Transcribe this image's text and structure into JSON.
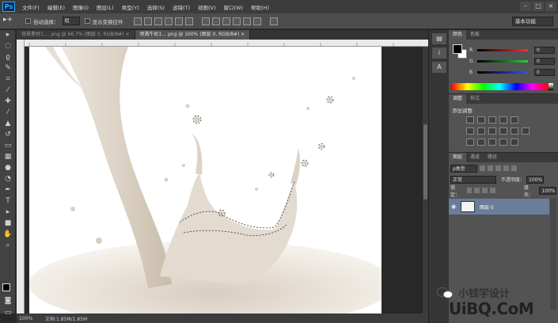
{
  "menubar": {
    "logo": "Ps",
    "items": [
      "文件(F)",
      "编辑(E)",
      "图像(I)",
      "图层(L)",
      "类型(Y)",
      "选择(S)",
      "滤镜(T)",
      "视图(V)",
      "窗口(W)",
      "帮助(H)"
    ]
  },
  "options": {
    "auto_select_label": "自动选择：",
    "auto_select_value": "组",
    "show_transform_label": "显示变换控件",
    "workspace": "基本功能"
  },
  "tabs": [
    {
      "label": "背景素材1.... png @ 66.7% (图层 0, RGB/8#) ×",
      "active": false
    },
    {
      "label": "喷溅牛奶1... png @ 100% (图层 0, RGB/8#) ×",
      "active": true
    }
  ],
  "status": {
    "zoom": "100%",
    "doc": "文档:1.85M/1.85M"
  },
  "color_panel": {
    "tabs": [
      "颜色",
      "色板"
    ],
    "r_label": "R",
    "g_label": "G",
    "b_label": "B",
    "r_value": "0",
    "g_value": "0",
    "b_value": "0",
    "colors": {
      "r_track": "#ff3030",
      "g_track": "#2ecc40",
      "b_track": "#3050ff"
    }
  },
  "adjust_panel": {
    "tabs": [
      "调整",
      "样式"
    ],
    "title": "添加调整"
  },
  "layers_panel": {
    "tabs": [
      "图层",
      "通道",
      "路径"
    ],
    "filter_kind": "ρ类型",
    "blend_mode": "正常",
    "opacity_label": "不透明度：",
    "opacity_value": "100%",
    "lock_label": "锁定：",
    "fill_label": "填充：",
    "fill_value": "100%",
    "layer_name": "图层 0"
  },
  "watermark": {
    "cn": "小钱学设计",
    "en": "UiBQ.CoM"
  }
}
